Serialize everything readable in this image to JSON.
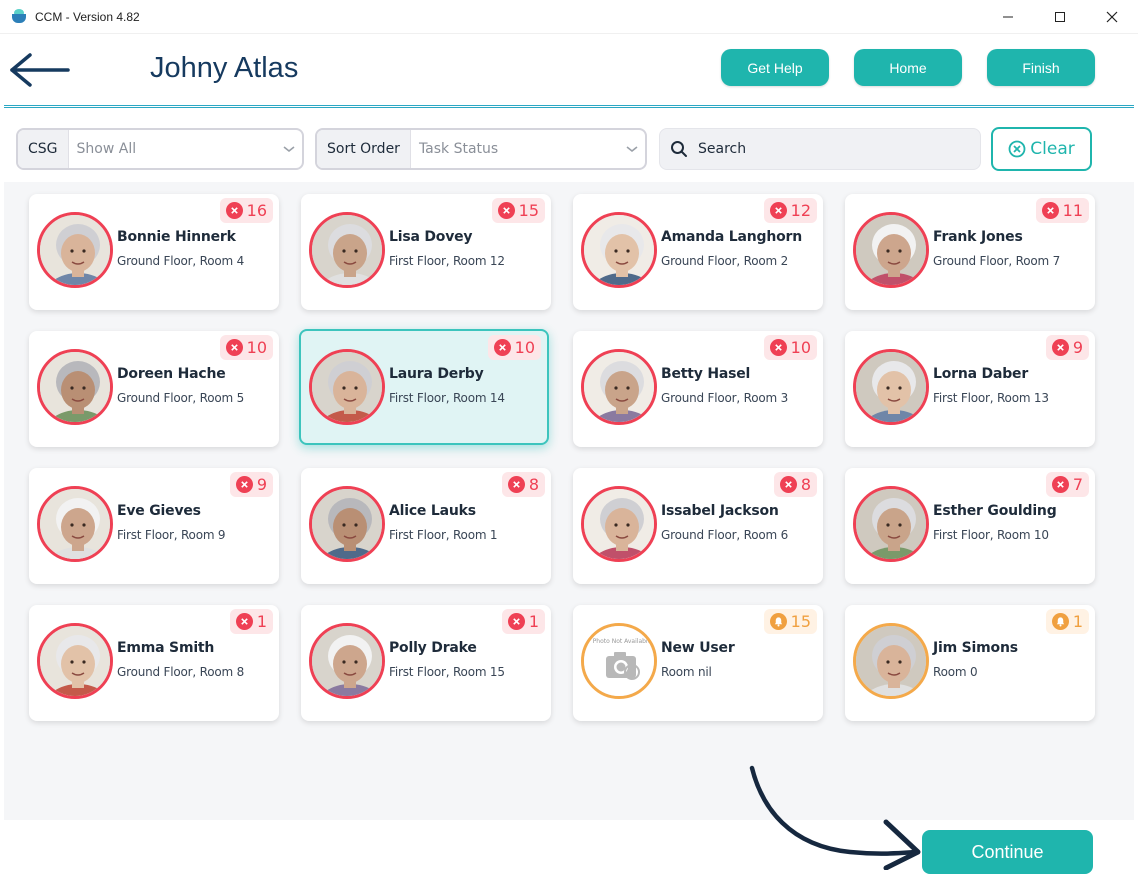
{
  "window": {
    "title": "CCM - Version 4.82"
  },
  "header": {
    "user_name": "Johny Atlas",
    "buttons": {
      "help": "Get Help",
      "home": "Home",
      "finish": "Finish"
    }
  },
  "filters": {
    "csg": {
      "label": "CSG",
      "value": "Show All"
    },
    "sort": {
      "label": "Sort Order",
      "value": "Task Status"
    },
    "search": {
      "placeholder": "Search"
    },
    "clear_label": "Clear"
  },
  "colors": {
    "accent": "#1fb5ad",
    "alert": "#ef4054",
    "warning": "#f0a040",
    "navy": "#163a5f"
  },
  "residents": [
    {
      "name": "Bonnie Hinnerk",
      "room": "Ground Floor, Room 4",
      "count": "16",
      "status": "alert",
      "icon": "close-circle-icon"
    },
    {
      "name": "Lisa Dovey",
      "room": "First Floor, Room 12",
      "count": "15",
      "status": "alert",
      "icon": "close-circle-icon"
    },
    {
      "name": "Amanda Langhorn",
      "room": "Ground Floor, Room 2",
      "count": "12",
      "status": "alert",
      "icon": "close-circle-icon"
    },
    {
      "name": "Frank Jones",
      "room": "Ground Floor, Room 7",
      "count": "11",
      "status": "alert",
      "icon": "close-circle-icon"
    },
    {
      "name": "Doreen Hache",
      "room": "Ground Floor, Room 5",
      "count": "10",
      "status": "alert",
      "icon": "close-circle-icon"
    },
    {
      "name": "Laura Derby",
      "room": "First Floor, Room 14",
      "count": "10",
      "status": "alert",
      "icon": "close-circle-icon",
      "selected": true
    },
    {
      "name": "Betty Hasel",
      "room": "Ground Floor, Room 3",
      "count": "10",
      "status": "alert",
      "icon": "close-circle-icon"
    },
    {
      "name": "Lorna Daber",
      "room": "First Floor, Room 13",
      "count": "9",
      "status": "alert",
      "icon": "close-circle-icon"
    },
    {
      "name": "Eve Gieves",
      "room": "First Floor, Room 9",
      "count": "9",
      "status": "alert",
      "icon": "close-circle-icon"
    },
    {
      "name": "Alice Lauks",
      "room": "First Floor, Room 1",
      "count": "8",
      "status": "alert",
      "icon": "close-circle-icon"
    },
    {
      "name": "Issabel Jackson",
      "room": "Ground Floor, Room 6",
      "count": "8",
      "status": "alert",
      "icon": "close-circle-icon"
    },
    {
      "name": "Esther Goulding",
      "room": "First Floor, Room 10",
      "count": "7",
      "status": "alert",
      "icon": "close-circle-icon"
    },
    {
      "name": "Emma Smith",
      "room": "Ground Floor, Room 8",
      "count": "1",
      "status": "alert",
      "icon": "close-circle-icon"
    },
    {
      "name": "Polly Drake",
      "room": "First Floor, Room 15",
      "count": "1",
      "status": "alert",
      "icon": "close-circle-icon"
    },
    {
      "name": "New User",
      "room": "Room nil",
      "count": "15",
      "status": "warn",
      "icon": "bell-icon",
      "photo_missing": true,
      "photo_text": "Photo Not Available"
    },
    {
      "name": "Jim Simons",
      "room": "Room 0",
      "count": "1",
      "status": "warn",
      "icon": "bell-icon"
    }
  ],
  "footer": {
    "continue_label": "Continue"
  }
}
